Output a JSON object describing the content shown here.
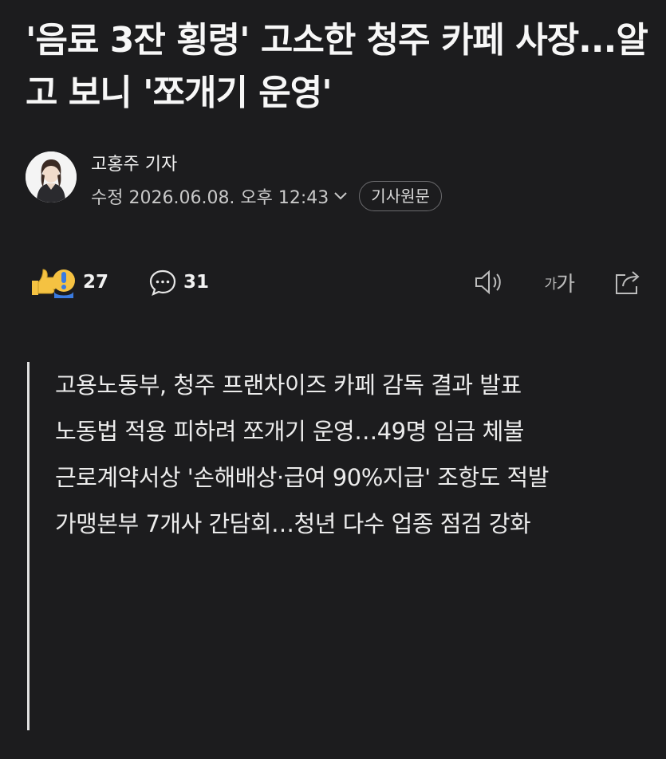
{
  "article": {
    "headline": "'음료 3잔 횡령' 고소한 청주 카페 사장...알고 보니 '쪼개기 운영'",
    "reporter": "고홍주 기자",
    "date": "수정 2026.06.08. 오후 12:43",
    "original_button": "기사원문"
  },
  "reactions": {
    "like_count": "27",
    "comment_count": "31"
  },
  "toolbar": {
    "font_size_label_small": "가",
    "font_size_label_large": "가"
  },
  "summary": [
    "고용노동부, 청주 프랜차이즈 카페 감독 결과 발표",
    "노동법 적용 피하려 쪼개기 운영…49명 임금 체불",
    "근로계약서상 '손해배상·급여 90%지급' 조항도 적발",
    "가맹본부 7개사 간담회…청년 다수 업종 점검 강화"
  ],
  "colors": {
    "background": "#1c1c1e",
    "text": "#f2f2f2",
    "muted": "#c9c9c9"
  },
  "icons": [
    "chevron-down-icon",
    "comment-icon",
    "speaker-icon",
    "share-icon",
    "like-emoji-icon",
    "surprise-emoji-icon"
  ]
}
